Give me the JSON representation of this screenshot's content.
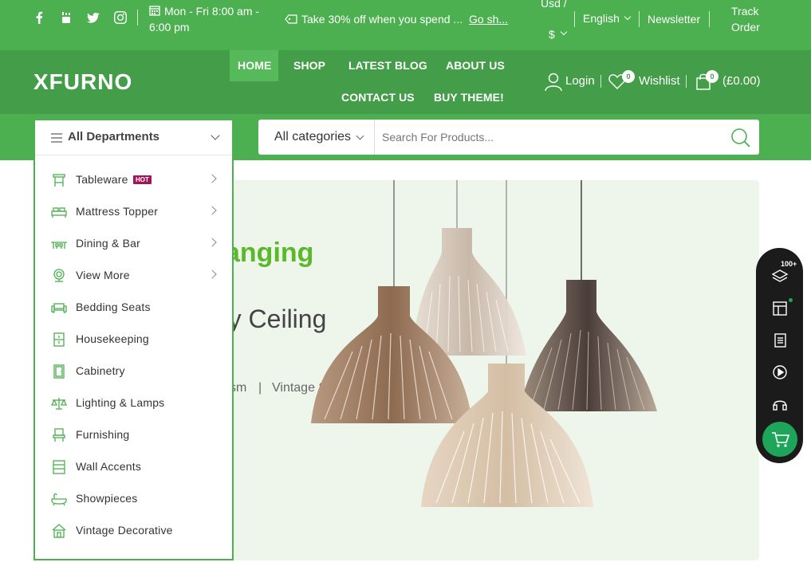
{
  "topbar": {
    "hours": "Mon - Fri 8:00 am -",
    "hours_line2": "6:00 pm",
    "promo": "Take 30% off when you spend ...",
    "promo_link": "Go sh...",
    "currency_line1": "Usd /",
    "currency_line2": "$",
    "language": "English",
    "newsletter": "Newsletter",
    "track_line1": "Track",
    "track_line2": "Order",
    "social_icons": [
      "facebook-icon",
      "youtube-icon",
      "twitter-icon",
      "instagram-icon"
    ]
  },
  "header": {
    "logo": "XFURNO",
    "nav": [
      "HOME",
      "SHOP",
      "LATEST BLOG",
      "ABOUT US",
      "CONTACT US",
      "BUY THEME!"
    ],
    "login": "Login",
    "wishlist": "Wishlist",
    "wishlist_count": "0",
    "cart_count": "0",
    "cart_total": "(£0.00)"
  },
  "search": {
    "departments_label": "All Departments",
    "category": "All categories",
    "placeholder": "Search For Products..."
  },
  "departments": [
    {
      "label": "Tableware",
      "badge": "HOT",
      "has_sub": true,
      "icon": "table-icon"
    },
    {
      "label": "Mattress Topper",
      "has_sub": true,
      "icon": "bed-icon"
    },
    {
      "label": "Dining & Bar",
      "has_sub": true,
      "icon": "dining-icon"
    },
    {
      "label": "View More",
      "has_sub": true,
      "icon": "lamp-icon"
    },
    {
      "label": "Bedding Seats",
      "has_sub": false,
      "icon": "sofa-icon"
    },
    {
      "label": "Housekeeping",
      "has_sub": false,
      "icon": "cabinet-icon"
    },
    {
      "label": "Cabinetry",
      "has_sub": false,
      "icon": "door-icon"
    },
    {
      "label": "Lighting & Lamps",
      "has_sub": false,
      "icon": "scale-lamp-icon"
    },
    {
      "label": "Furnishing",
      "has_sub": false,
      "icon": "chair-icon"
    },
    {
      "label": "Wall Accents",
      "has_sub": false,
      "icon": "shelf-icon"
    },
    {
      "label": "Showpieces",
      "has_sub": false,
      "icon": "bathtub-icon"
    },
    {
      "label": "Vintage Decorative",
      "has_sub": false,
      "icon": "house-icon"
    }
  ],
  "hero": {
    "headline": "anging",
    "subheadline": "ry Ceiling",
    "tagline_left": "sm",
    "tagline_sep": "|",
    "tagline_right": "Vintage Style"
  },
  "dock": {
    "badge": "100+",
    "icons": [
      "layers-icon",
      "layout-icon",
      "document-icon",
      "play-icon",
      "headset-icon",
      "cart-icon"
    ]
  },
  "colors": {
    "primary": "#4caf50",
    "primary_dark": "#449d48",
    "hot_badge": "#a0155a",
    "hero_bg": "#eef6ec",
    "dock_bg": "#1b1b1b",
    "dock_cart": "#1fa55a"
  }
}
